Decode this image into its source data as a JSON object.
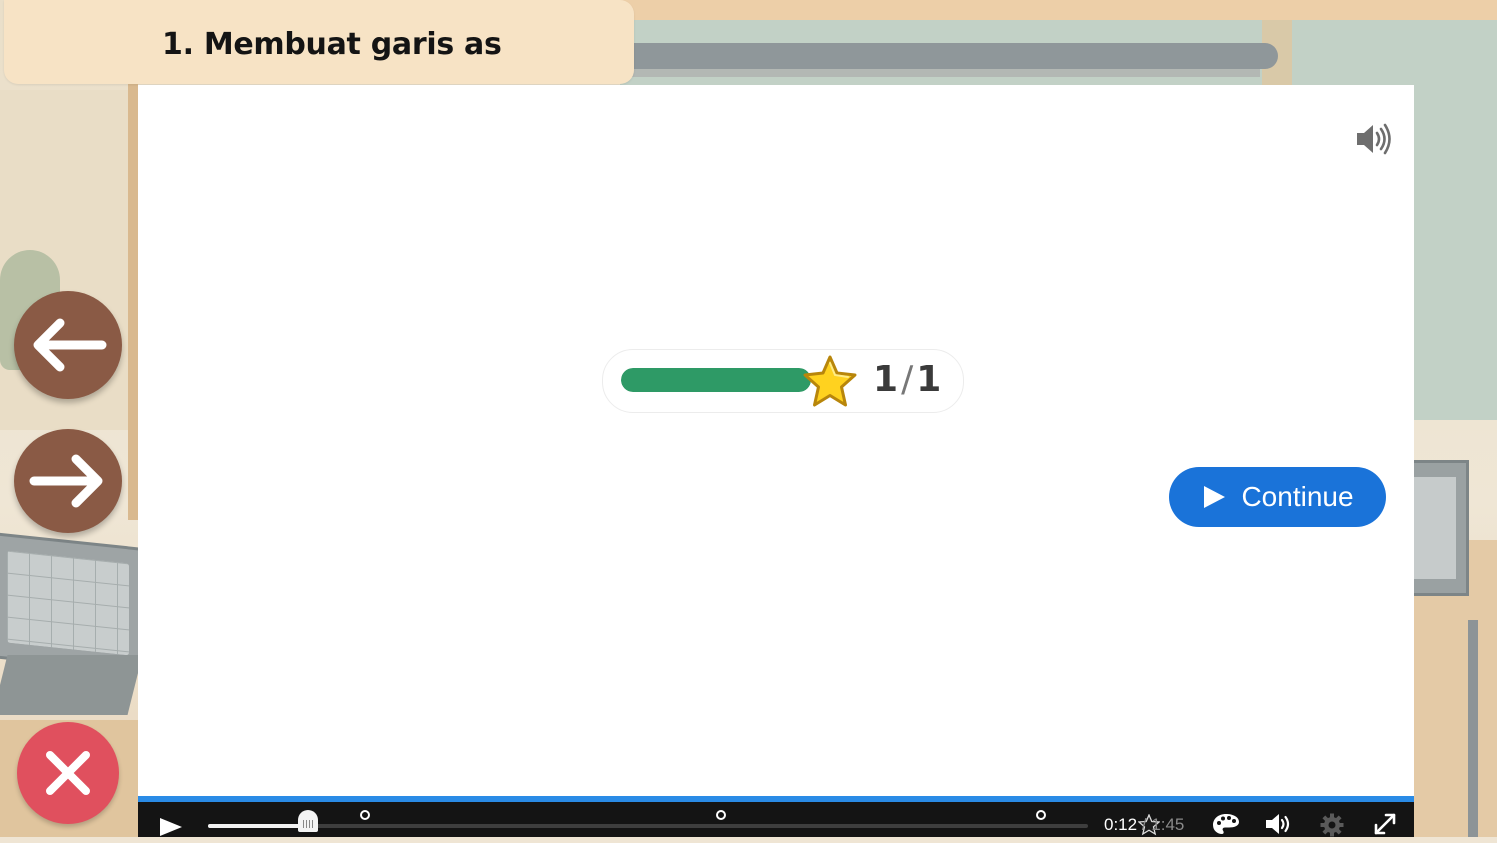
{
  "lesson": {
    "title": "1. Membuat garis as"
  },
  "progress": {
    "completed": "1",
    "separator": "/",
    "total": "1",
    "fraction": 1.0,
    "fill_color": "#2e9a66"
  },
  "actions": {
    "continue_label": "Continue",
    "continue_color": "#1a73d9"
  },
  "navigation": {
    "prev_icon": "arrow-left-icon",
    "next_icon": "arrow-right-icon",
    "close_icon": "close-icon",
    "nav_color": "#8a5a45",
    "close_color": "#e0505e"
  },
  "player": {
    "current_time": "0:12",
    "time_separator": "/",
    "duration": "1:45",
    "played_fraction": 0.114,
    "accent_color": "#2a8be6",
    "icons": [
      "play-icon",
      "palette-icon",
      "volume-icon",
      "gear-icon",
      "fullscreen-icon"
    ]
  },
  "panel_icons": {
    "sound": "speaker-icon"
  }
}
